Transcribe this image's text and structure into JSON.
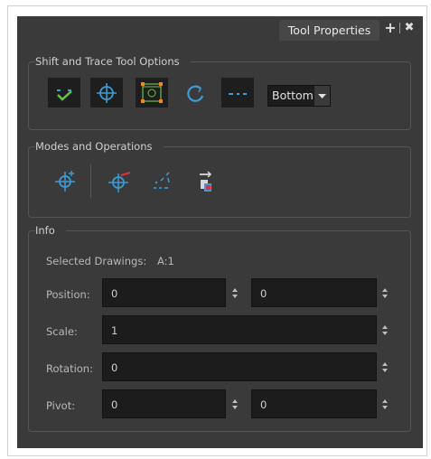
{
  "tab": {
    "title": "Tool Properties",
    "add_label": "+",
    "close_label": "✖"
  },
  "shift_trace": {
    "title": "Shift and Trace Tool Options",
    "buttons": [
      {
        "icon": "show-outline-icon",
        "active": false
      },
      {
        "icon": "crosshair-icon",
        "active": false
      },
      {
        "icon": "bounding-box-icon",
        "active": true
      },
      {
        "icon": "reset-loop-icon",
        "active": false
      },
      {
        "icon": "dashed-line-icon",
        "active": false
      }
    ],
    "position_select": {
      "value": "Bottom"
    }
  },
  "modes": {
    "title": "Modes and Operations",
    "buttons": [
      {
        "icon": "add-pivot-icon"
      },
      {
        "icon": "reset-pivot-icon"
      },
      {
        "icon": "reset-position-icon"
      },
      {
        "icon": "swap-drawing-icon"
      }
    ]
  },
  "info": {
    "title": "Info",
    "selected_label": "Selected Drawings:",
    "selected_value": "A:1",
    "position_label": "Position:",
    "position_x": "0",
    "position_y": "0",
    "scale_label": "Scale:",
    "scale_value": "1",
    "rotation_label": "Rotation:",
    "rotation_value": "0",
    "pivot_label": "Pivot:",
    "pivot_x": "0",
    "pivot_y": "0"
  },
  "colors": {
    "panel": "#3a3a3a",
    "field": "#1c1c1c",
    "accent_blue": "#3d9bd6",
    "accent_orange": "#f08a1c",
    "accent_green": "#6ac04a",
    "accent_red": "#e0323c"
  }
}
